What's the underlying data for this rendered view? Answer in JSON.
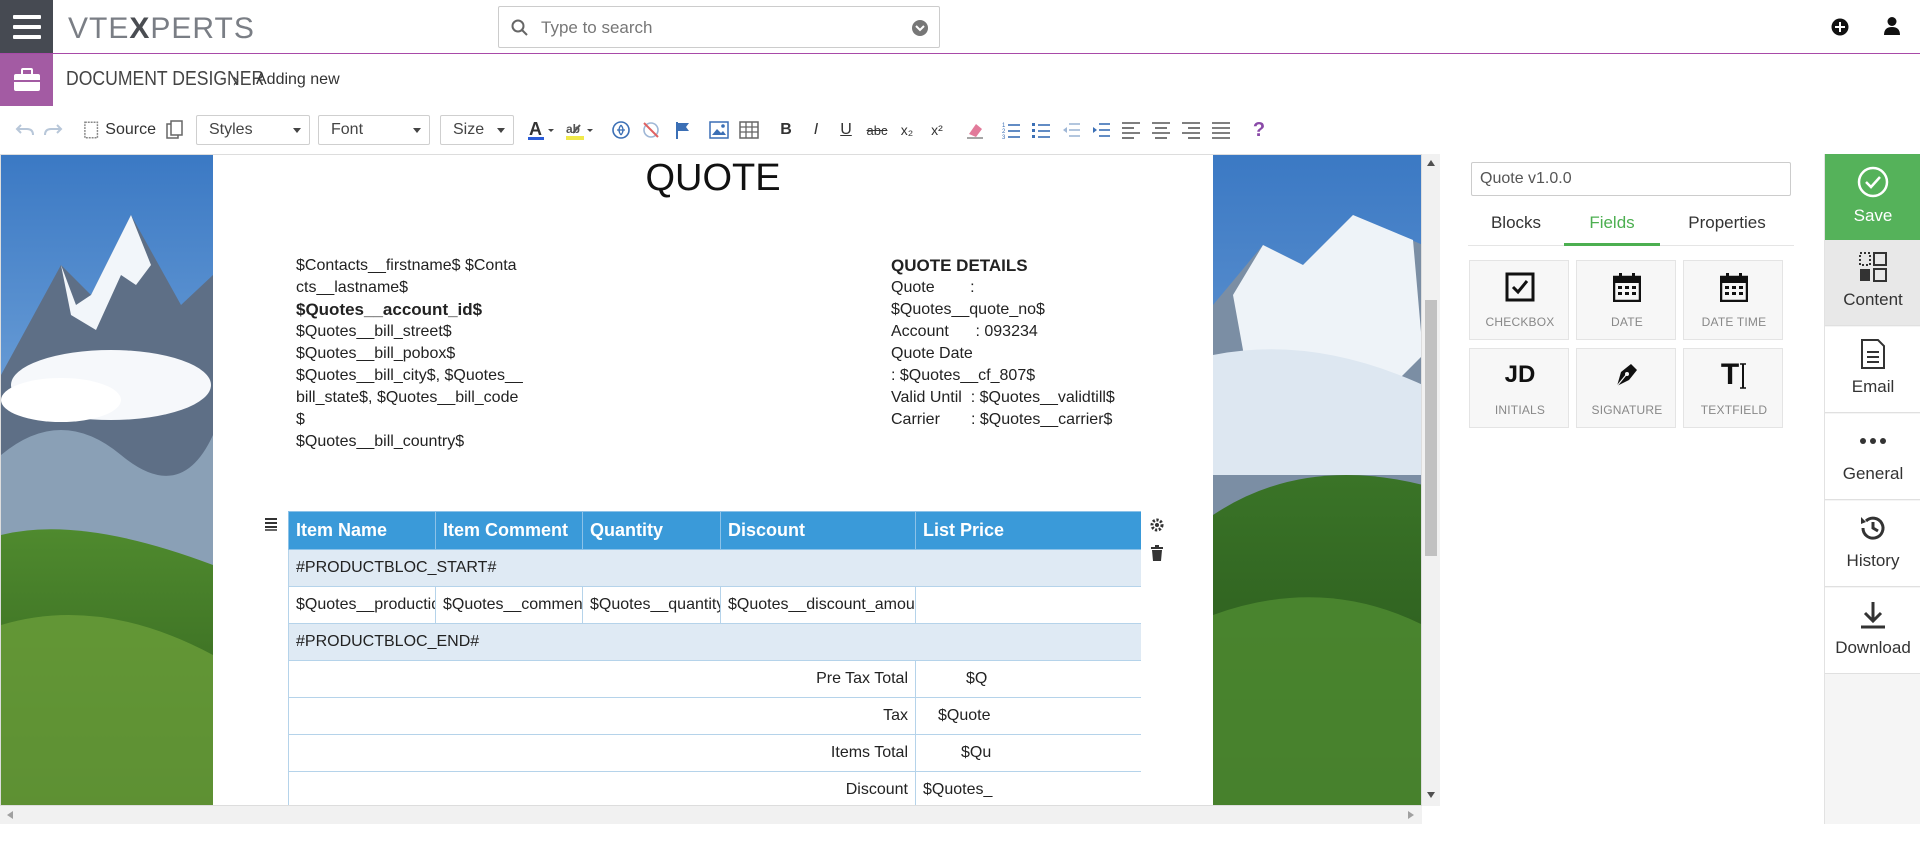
{
  "header": {
    "logo_prefix": "VTE",
    "logo_x": "X",
    "logo_suffix": "PERTS",
    "search_placeholder": "Type to search"
  },
  "module": {
    "title": "DOCUMENT DESIGNER",
    "breadcrumb_sep": "›",
    "subtitle": "Adding new"
  },
  "toolbar": {
    "source_label": "Source",
    "styles_label": "Styles",
    "font_label": "Font",
    "size_label": "Size",
    "bold": "B",
    "italic": "I",
    "underline": "U",
    "strike": "abc",
    "subscript": "x₂",
    "superscript": "x²",
    "help": "?"
  },
  "document": {
    "title": "QUOTE",
    "address_lines": [
      "$Contacts__firstname$ $Conta",
      "cts__lastname$",
      "$Quotes__account_id$",
      "$Quotes__bill_street$",
      "$Quotes__bill_pobox$",
      "$Quotes__bill_city$, $Quotes__",
      "bill_state$, $Quotes__bill_code",
      "$",
      "$Quotes__bill_country$"
    ],
    "details_heading": "QUOTE DETAILS",
    "details_lines": [
      "Quote        :",
      "$Quotes__quote_no$",
      "Account      : 093234",
      "Quote Date",
      ": $Quotes__cf_807$",
      "Valid Until  : $Quotes__validtill$",
      "Carrier       : $Quotes__carrier$"
    ],
    "table": {
      "headers": [
        "Item Name",
        "Item Comment",
        "Quantity",
        "Discount",
        "List Price"
      ],
      "start_marker": "#PRODUCTBLOC_START#",
      "product_row": [
        "$Quotes__productid$",
        "$Quotes__comment$",
        "$Quotes__quantity$",
        "$Quotes__discount_amount$",
        ""
      ],
      "end_marker": "#PRODUCTBLOC_END#",
      "totals": [
        {
          "label": "Pre Tax Total",
          "value": "$Q"
        },
        {
          "label": "Tax",
          "value": "$Quote"
        },
        {
          "label": "Items Total",
          "value": "$Qu"
        },
        {
          "label": "Discount",
          "value": "$Quotes_"
        }
      ]
    }
  },
  "panel": {
    "template_name": "Quote v1.0.0",
    "tabs": [
      "Blocks",
      "Fields",
      "Properties"
    ],
    "active_tab": "Fields",
    "fields": [
      {
        "label": "CHECKBOX",
        "icon": "checkbox-icon"
      },
      {
        "label": "DATE",
        "icon": "calendar-icon"
      },
      {
        "label": "DATE TIME",
        "icon": "calendar-icon"
      },
      {
        "label": "INITIALS",
        "icon": "initials-icon",
        "glyph": "JD"
      },
      {
        "label": "SIGNATURE",
        "icon": "pen-icon"
      },
      {
        "label": "TEXTFIELD",
        "icon": "text-cursor-icon",
        "glyph": "T"
      }
    ]
  },
  "sidebar": {
    "save": "Save",
    "items": [
      {
        "label": "Content",
        "icon": "content-icon"
      },
      {
        "label": "Email",
        "icon": "email-icon"
      },
      {
        "label": "General",
        "icon": "more-icon"
      },
      {
        "label": "History",
        "icon": "history-icon"
      },
      {
        "label": "Download",
        "icon": "download-icon"
      }
    ]
  },
  "colors": {
    "accent_purple": "#a35ba3",
    "save_green": "#55b25a",
    "table_header_blue": "#3a9ad9",
    "active_tab_green": "#4caf50"
  }
}
